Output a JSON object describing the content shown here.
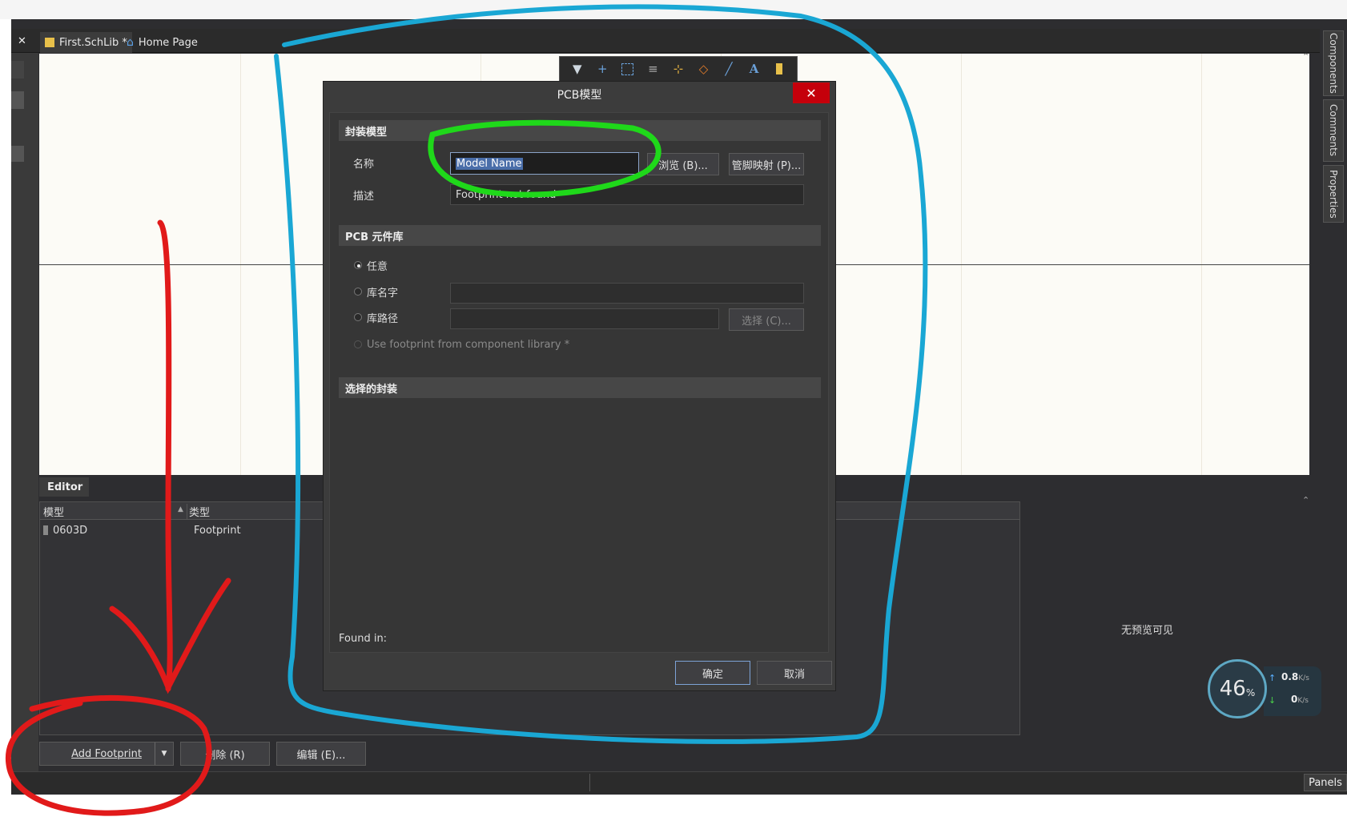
{
  "tabs": [
    {
      "label": "First.SchLib *"
    },
    {
      "label": "Home Page"
    }
  ],
  "right_panels": [
    "Components",
    "Comments",
    "Properties"
  ],
  "editor": {
    "title": "Editor",
    "columns": [
      "模型",
      "类型"
    ],
    "rows": [
      {
        "model": "0603D",
        "type": "Footprint"
      }
    ],
    "no_preview": "无预览可见",
    "buttons": {
      "add": "Add Footprint",
      "delete": "删除 (R)",
      "edit": "编辑 (E)..."
    }
  },
  "dialog": {
    "title": "PCB模型",
    "section_footprint": "封装模型",
    "name_label": "名称",
    "name_value": "Model Name",
    "browse_button": "浏览 (B)...",
    "pinmap_button": "管脚映射 (P)...",
    "desc_label": "描述",
    "desc_value": "Footprint not found",
    "section_library": "PCB 元件库",
    "opt_any": "任意",
    "opt_libname": "库名字",
    "opt_libpath": "库路径",
    "choose_button": "选择 (C)...",
    "opt_component": "Use footprint from component library *",
    "section_selected": "选择的封装",
    "found_in": "Found in:",
    "ok": "确定",
    "cancel": "取消"
  },
  "net_monitor": {
    "percent": "46",
    "percent_unit": "%",
    "up": "0.8",
    "down": "0",
    "unit": "K/s"
  },
  "status": {
    "panels": "Panels"
  },
  "colors": {
    "annotation_blue": "#1aa7d4",
    "annotation_green": "#1fd81a",
    "annotation_red": "#e11a1a"
  }
}
